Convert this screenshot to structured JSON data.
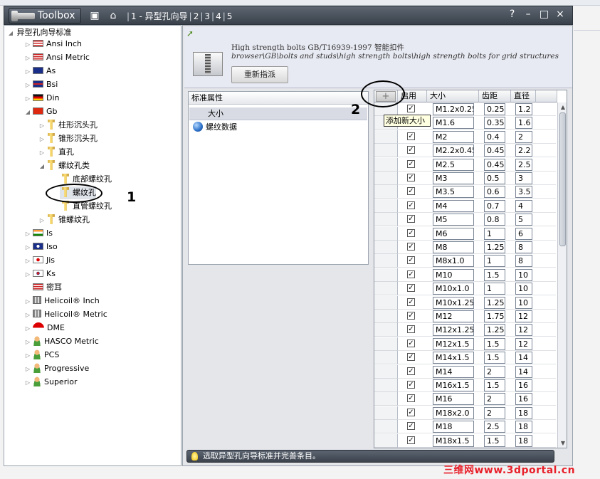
{
  "window": {
    "app_name": "Toolbox",
    "breadcrumb": [
      "1 - 异型孔向导",
      "2",
      "3",
      "4",
      "5"
    ],
    "help": "?",
    "minimize": "–",
    "maximize": "□",
    "close": "×"
  },
  "tree": {
    "root": "异型孔向导标准",
    "items": [
      {
        "label": "Ansi Inch",
        "icon": "us-flag-icon"
      },
      {
        "label": "Ansi Metric",
        "icon": "us-flag-icon"
      },
      {
        "label": "As",
        "icon": "australia-flag-icon"
      },
      {
        "label": "Bsi",
        "icon": "uk-flag-icon"
      },
      {
        "label": "Din",
        "icon": "germany-flag-icon"
      },
      {
        "label": "Gb",
        "icon": "china-flag-icon"
      },
      {
        "label": "柱形沉头孔",
        "icon": "hole-icon"
      },
      {
        "label": "锥形沉头孔",
        "icon": "hole-icon"
      },
      {
        "label": "直孔",
        "icon": "hole-icon"
      },
      {
        "label": "螺纹孔类",
        "icon": "hole-icon"
      },
      {
        "label": "底部螺纹孔",
        "icon": "hole-icon"
      },
      {
        "label": "螺纹孔",
        "icon": "hole-icon"
      },
      {
        "label": "直管螺纹孔",
        "icon": "hole-icon"
      },
      {
        "label": "锥螺纹孔",
        "icon": "hole-icon"
      },
      {
        "label": "Is",
        "icon": "india-flag-icon"
      },
      {
        "label": "Iso",
        "icon": "iso-flag-icon"
      },
      {
        "label": "Jis",
        "icon": "japan-flag-icon"
      },
      {
        "label": "Ks",
        "icon": "korea-flag-icon"
      },
      {
        "label": "密耳",
        "icon": "us-flag-icon"
      },
      {
        "label": "Helicoil® Inch",
        "icon": "helicoil-icon"
      },
      {
        "label": "Helicoil® Metric",
        "icon": "helicoil-icon"
      },
      {
        "label": "DME",
        "icon": "dme-logo-icon"
      },
      {
        "label": "HASCO Metric",
        "icon": "user-icon"
      },
      {
        "label": "PCS",
        "icon": "user-icon"
      },
      {
        "label": "Progressive",
        "icon": "user-icon"
      },
      {
        "label": "Superior",
        "icon": "user-icon"
      }
    ]
  },
  "info": {
    "title": "High strength bolts GB/T16939-1997 智能扣件",
    "path": "browser\\GB\\bolts and studs\\high strength bolts\\high strength bolts for grid structures",
    "reset_button": "重新指派"
  },
  "properties": {
    "header": "标准属性",
    "selected": "大小",
    "item": "螺纹数据"
  },
  "table": {
    "headers": {
      "enabled": "启用",
      "size": "大小",
      "pitch": "齿距",
      "diameter": "直径"
    },
    "add_button": "+",
    "add_tooltip": "添加新大小",
    "rows": [
      {
        "size": "M1.2x0.25",
        "pitch": "0.25",
        "dia": "1.2"
      },
      {
        "size": "M1.6",
        "pitch": "0.35",
        "dia": "1.6"
      },
      {
        "size": "M2",
        "pitch": "0.4",
        "dia": "2"
      },
      {
        "size": "M2.2x0.45",
        "pitch": "0.45",
        "dia": "2.2"
      },
      {
        "size": "M2.5",
        "pitch": "0.45",
        "dia": "2.5"
      },
      {
        "size": "M3",
        "pitch": "0.5",
        "dia": "3"
      },
      {
        "size": "M3.5",
        "pitch": "0.6",
        "dia": "3.5"
      },
      {
        "size": "M4",
        "pitch": "0.7",
        "dia": "4"
      },
      {
        "size": "M5",
        "pitch": "0.8",
        "dia": "5"
      },
      {
        "size": "M6",
        "pitch": "1",
        "dia": "6"
      },
      {
        "size": "M8",
        "pitch": "1.25",
        "dia": "8"
      },
      {
        "size": "M8x1.0",
        "pitch": "1",
        "dia": "8"
      },
      {
        "size": "M10",
        "pitch": "1.5",
        "dia": "10"
      },
      {
        "size": "M10x1.0",
        "pitch": "1",
        "dia": "10"
      },
      {
        "size": "M10x1.25",
        "pitch": "1.25",
        "dia": "10"
      },
      {
        "size": "M12",
        "pitch": "1.75",
        "dia": "12"
      },
      {
        "size": "M12x1.25",
        "pitch": "1.25",
        "dia": "12"
      },
      {
        "size": "M12x1.5",
        "pitch": "1.5",
        "dia": "12"
      },
      {
        "size": "M14x1.5",
        "pitch": "1.5",
        "dia": "14"
      },
      {
        "size": "M14",
        "pitch": "2",
        "dia": "14"
      },
      {
        "size": "M16x1.5",
        "pitch": "1.5",
        "dia": "16"
      },
      {
        "size": "M16",
        "pitch": "2",
        "dia": "16"
      },
      {
        "size": "M18x2.0",
        "pitch": "2",
        "dia": "18"
      },
      {
        "size": "M18",
        "pitch": "2.5",
        "dia": "18"
      },
      {
        "size": "M18x1.5",
        "pitch": "1.5",
        "dia": "18"
      }
    ]
  },
  "status": {
    "text": "选取异型孔向导标准并完善条目。"
  },
  "annotations": {
    "one": "1",
    "two": "2"
  },
  "watermark": "三维网www.3dportal.cn",
  "colors": {
    "accent_red": "#e8202a",
    "titlebar": "#4a525c"
  }
}
